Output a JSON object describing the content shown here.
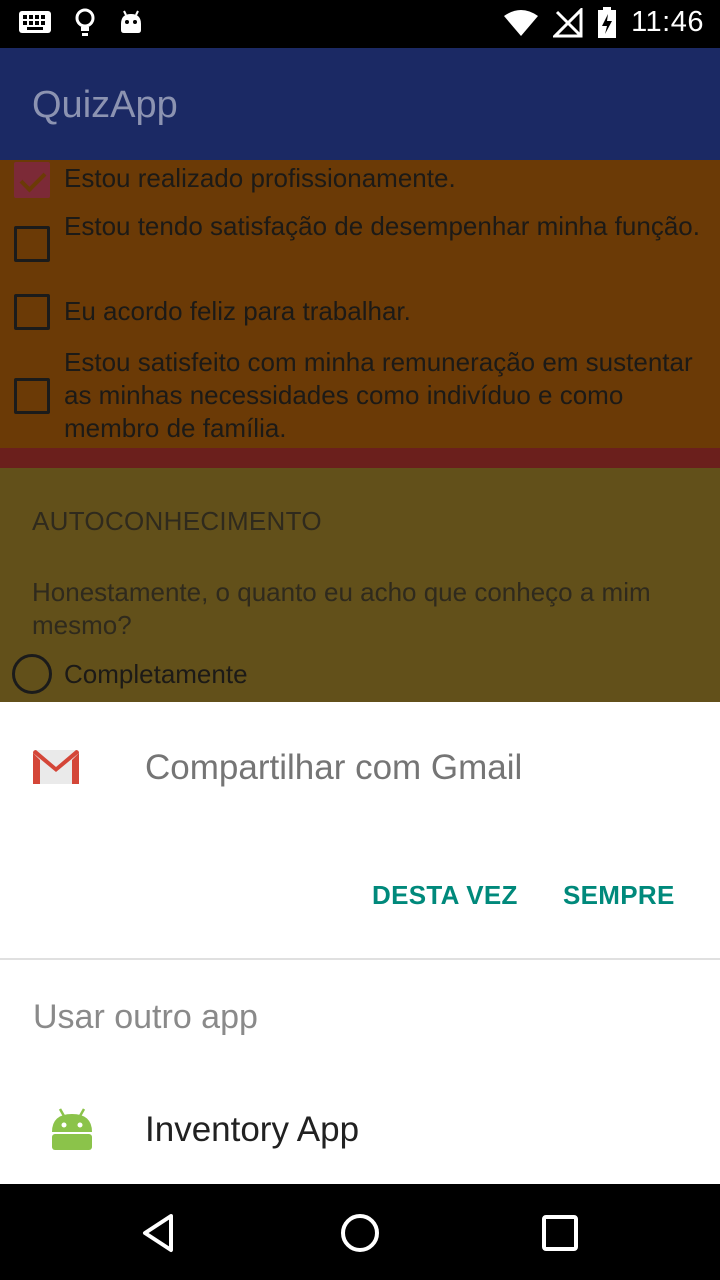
{
  "status_bar": {
    "time": "11:46",
    "left_icons": [
      "keyboard-icon",
      "bulb-icon",
      "android-debug-icon"
    ],
    "right_icons": [
      "wifi-icon",
      "no-signal-icon",
      "battery-charging-icon"
    ]
  },
  "app_bar": {
    "title": "QuizApp",
    "color": "#1b2964"
  },
  "questions_block_1": {
    "items": [
      {
        "label": "Estou realizado profissionamente.",
        "checked": true
      },
      {
        "label": "Estou tendo satisfação de desempenhar minha função.",
        "checked": false
      },
      {
        "label": "Eu acordo feliz para trabalhar.",
        "checked": false
      },
      {
        "label": "Estou satisfeito com minha remuneração em sustentar as minhas necessidades como indivíduo e como membro de família.",
        "checked": false
      }
    ]
  },
  "section_2": {
    "title": "AUTOCONHECIMENTO",
    "question": "Honestamente, o quanto eu acho que conheço a mim mesmo?",
    "options": [
      {
        "label": "Completamente",
        "selected": false
      }
    ]
  },
  "share_sheet": {
    "primary_label": "Compartilhar com Gmail",
    "primary_icon": "gmail-icon",
    "just_once_label": "DESTA VEZ",
    "always_label": "SEMPRE",
    "other_header": "Usar outro app",
    "apps": [
      {
        "label": "Inventory App",
        "icon": "android-icon"
      }
    ],
    "accent_color": "#00897b"
  },
  "nav_bar": {
    "buttons": [
      "back-icon",
      "home-icon",
      "recents-icon"
    ]
  }
}
